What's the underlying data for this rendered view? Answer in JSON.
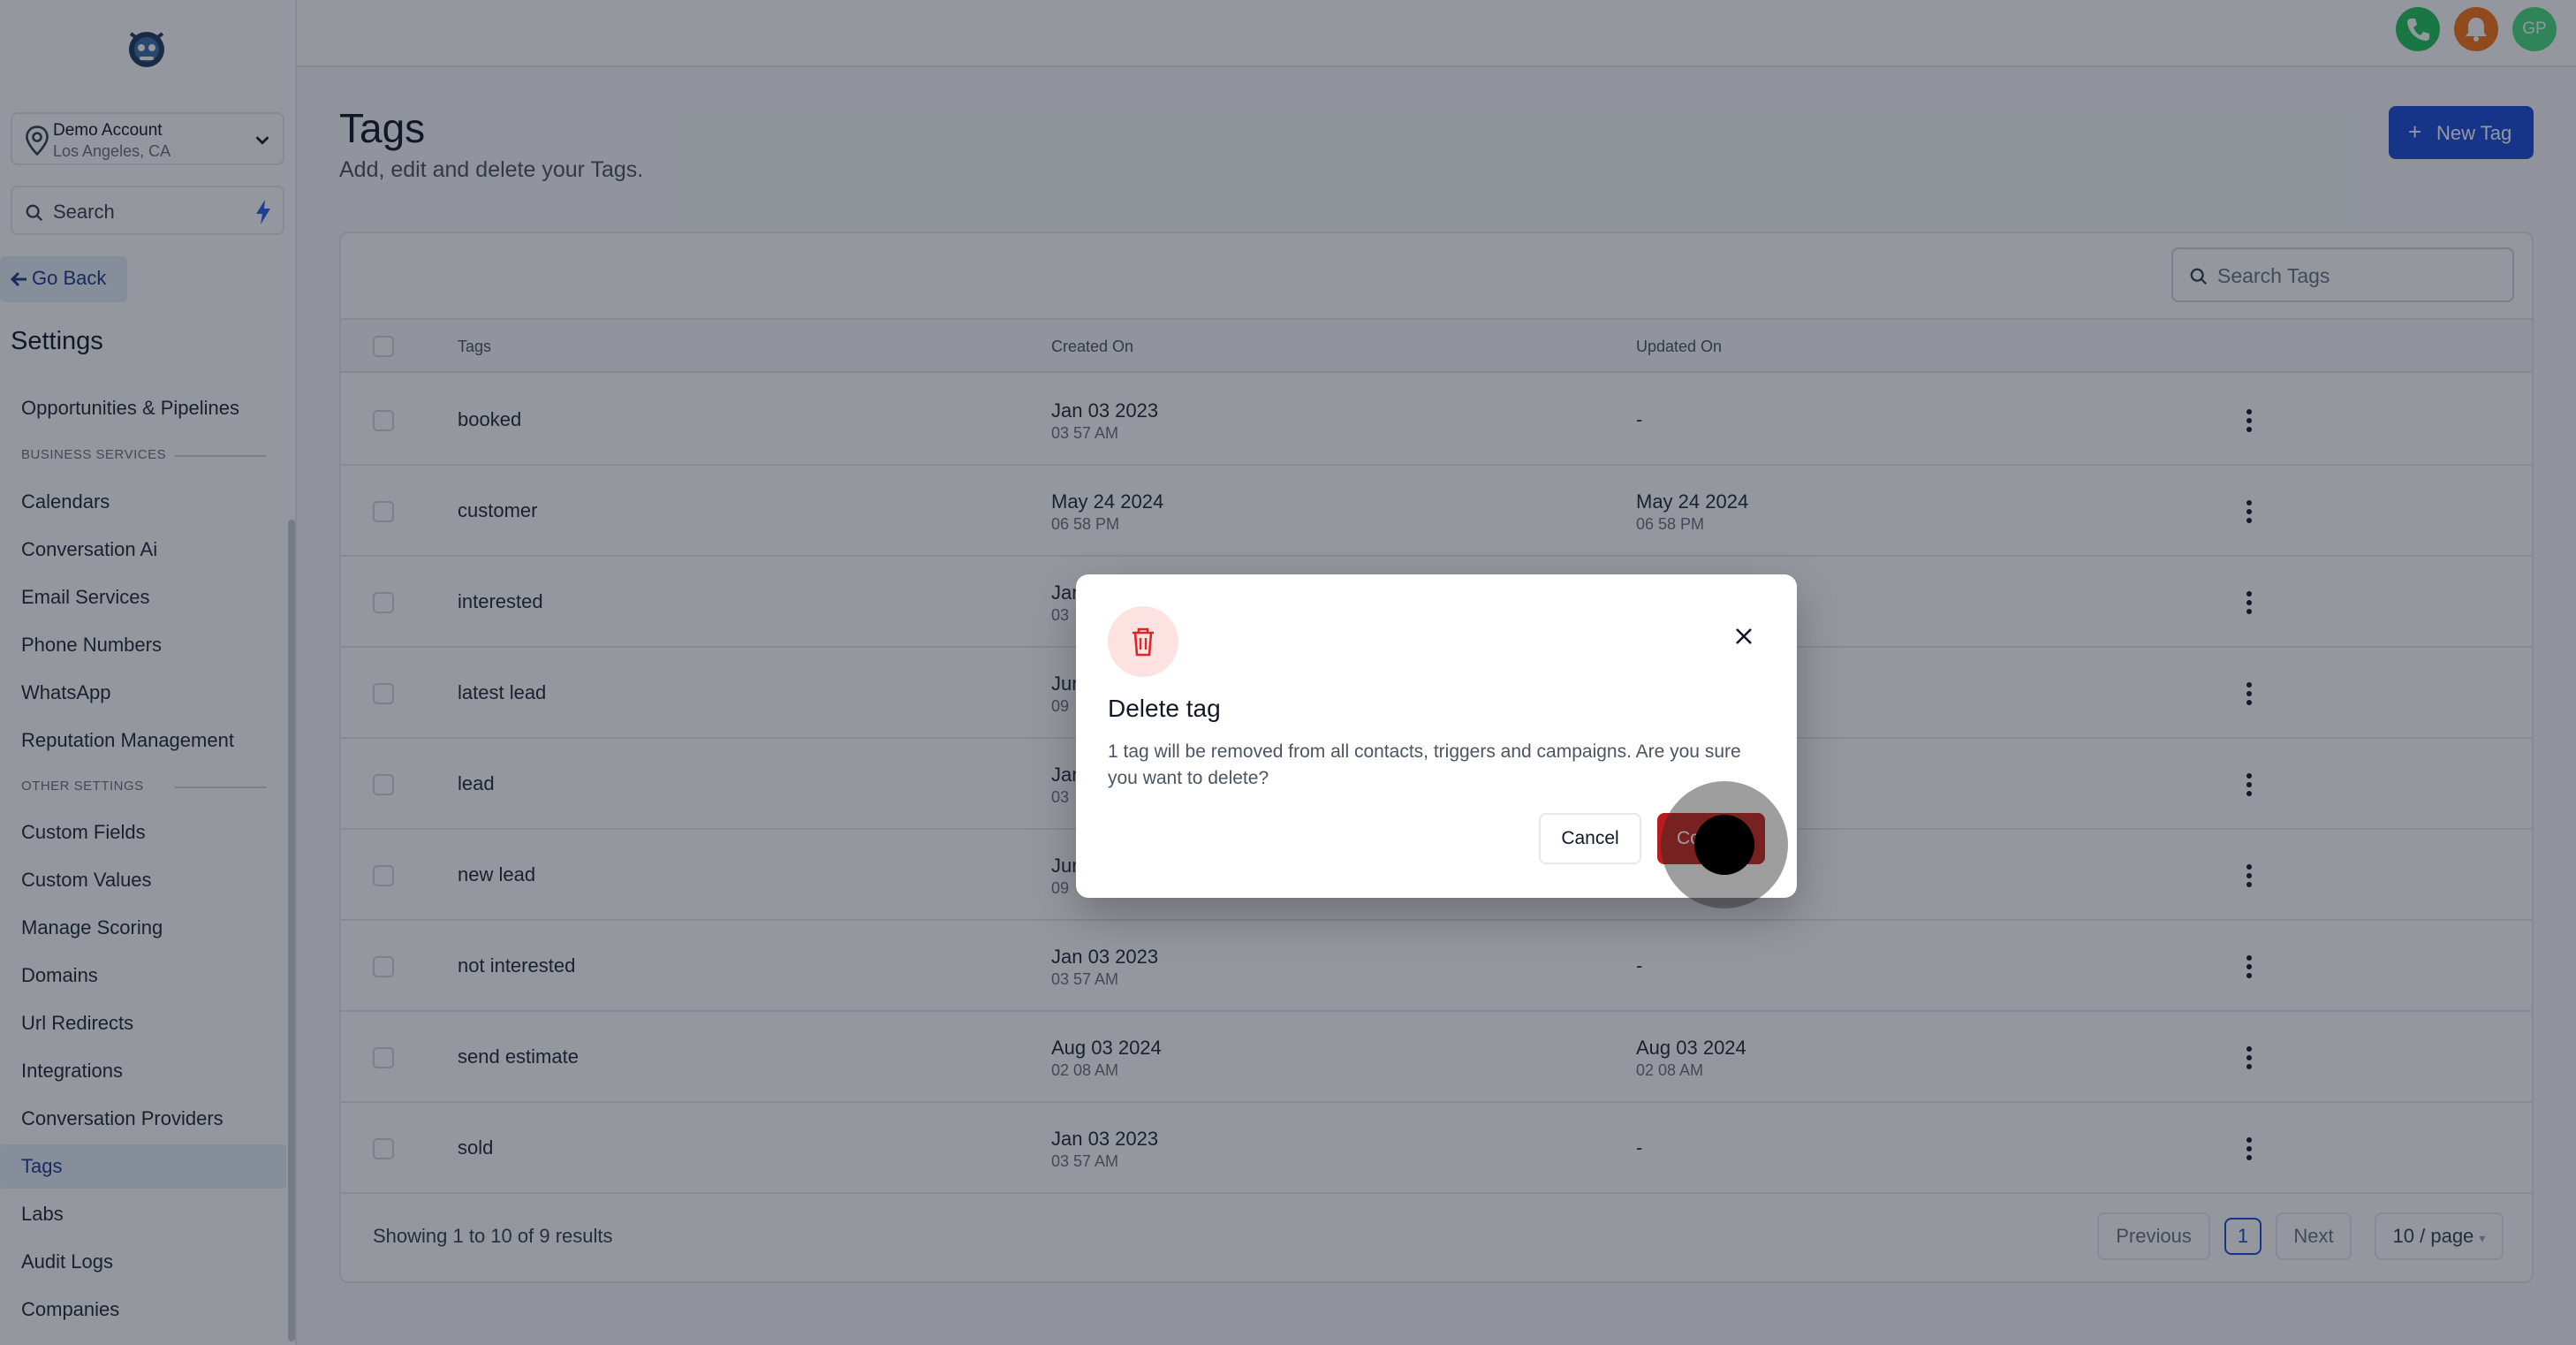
{
  "sidebar": {
    "account": {
      "name": "Demo Account",
      "location": "Los Angeles, CA"
    },
    "search_label": "Search",
    "go_back": "Go Back",
    "settings_title": "Settings",
    "items": [
      {
        "label": "Opportunities & Pipelines"
      },
      {
        "section": "BUSINESS SERVICES"
      },
      {
        "label": "Calendars"
      },
      {
        "label": "Conversation Ai"
      },
      {
        "label": "Email Services"
      },
      {
        "label": "Phone Numbers"
      },
      {
        "label": "WhatsApp"
      },
      {
        "label": "Reputation Management"
      },
      {
        "section": "OTHER SETTINGS"
      },
      {
        "label": "Custom Fields"
      },
      {
        "label": "Custom Values"
      },
      {
        "label": "Manage Scoring"
      },
      {
        "label": "Domains"
      },
      {
        "label": "Url Redirects"
      },
      {
        "label": "Integrations"
      },
      {
        "label": "Conversation Providers"
      },
      {
        "label": "Tags",
        "active": true
      },
      {
        "label": "Labs"
      },
      {
        "label": "Audit Logs"
      },
      {
        "label": "Companies"
      }
    ]
  },
  "topbar": {
    "avatar_initials": "GP",
    "phone_icon_color": "#22c55e",
    "bell_icon_color": "#f97316"
  },
  "page": {
    "title": "Tags",
    "subtitle": "Add, edit and delete your Tags.",
    "new_tag_label": "New Tag",
    "search_placeholder": "Search Tags"
  },
  "table": {
    "headers": {
      "tags": "Tags",
      "created": "Created On",
      "updated": "Updated On"
    },
    "rows": [
      {
        "tag": "booked",
        "created_date": "Jan 03 2023",
        "created_time": "03 57 AM",
        "updated_date": "-",
        "updated_time": ""
      },
      {
        "tag": "customer",
        "created_date": "May 24 2024",
        "created_time": "06 58 PM",
        "updated_date": "May 24 2024",
        "updated_time": "06 58 PM"
      },
      {
        "tag": "interested",
        "created_date": "Jan",
        "created_time": "03",
        "updated_date": "",
        "updated_time": ""
      },
      {
        "tag": "latest lead",
        "created_date": "Jun",
        "created_time": "09",
        "updated_date": "",
        "updated_time": ""
      },
      {
        "tag": "lead",
        "created_date": "Jan",
        "created_time": "03",
        "updated_date": "",
        "updated_time": ""
      },
      {
        "tag": "new lead",
        "created_date": "Jun",
        "created_time": "09",
        "updated_date": "",
        "updated_time": ""
      },
      {
        "tag": "not interested",
        "created_date": "Jan 03 2023",
        "created_time": "03 57 AM",
        "updated_date": "-",
        "updated_time": ""
      },
      {
        "tag": "send estimate",
        "created_date": "Aug 03 2024",
        "created_time": "02 08 AM",
        "updated_date": "Aug 03 2024",
        "updated_time": "02 08 AM"
      },
      {
        "tag": "sold",
        "created_date": "Jan 03 2023",
        "created_time": "03 57 AM",
        "updated_date": "-",
        "updated_time": ""
      }
    ],
    "showing": "Showing 1 to 10 of 9 results",
    "pagination": {
      "previous": "Previous",
      "page": "1",
      "next": "Next",
      "page_size": "10 / page"
    }
  },
  "modal": {
    "title": "Delete tag",
    "description": "1 tag will be removed from all contacts, triggers and campaigns. Are you sure you want to delete?",
    "cancel_label": "Cancel",
    "confirm_label_visible": "Co",
    "accent_color": "#b91c1c"
  }
}
